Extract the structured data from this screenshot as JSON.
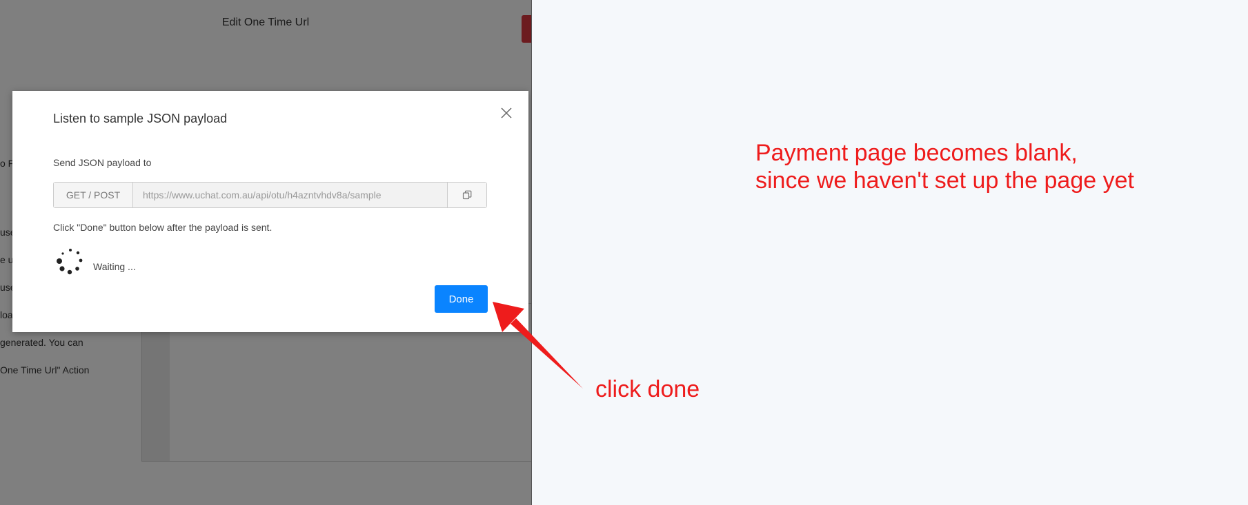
{
  "background_app": {
    "page_title": "Edit One Time Url",
    "fragments": [
      {
        "text": "o Fo"
      },
      {
        "text": "use"
      },
      {
        "text": "e ur"
      },
      {
        "text": "use"
      },
      {
        "text": "loa"
      },
      {
        "text": " generated. You can"
      },
      {
        "text": " One Time Url\" Action"
      }
    ]
  },
  "modal": {
    "title": "Listen to sample JSON payload",
    "send_label": "Send JSON payload to",
    "method": "GET / POST",
    "url_value": "https://www.uchat.com.au/api/otu/h4azntvhdv8a/sample",
    "hint": "Click \"Done\" button below after the payload is sent.",
    "waiting_text": "Waiting ...",
    "done_label": "Done"
  },
  "annotations": {
    "main_note": "Payment page becomes blank,\nsince we haven't set up the page yet",
    "click_note": "click done",
    "color": "#ee1c1c"
  },
  "icons": {
    "close": "close-icon",
    "copy": "copy-icon",
    "spinner": "loading-spinner-icon"
  },
  "colors": {
    "primary": "#0a84ff",
    "overlay": "rgba(0,0,0,0.5)"
  }
}
